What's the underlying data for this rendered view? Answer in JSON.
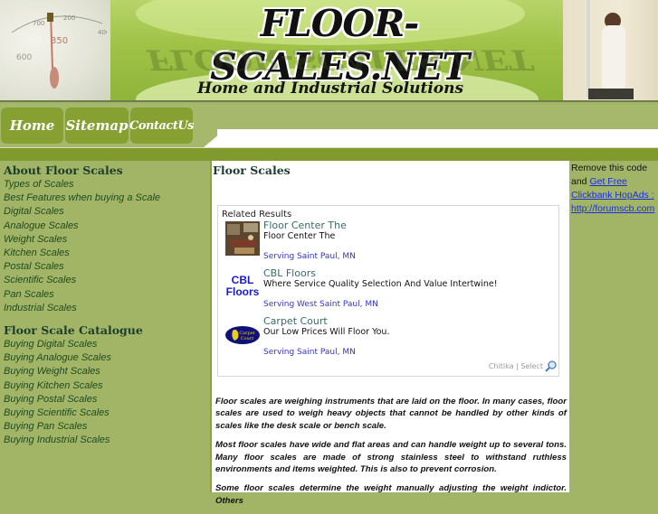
{
  "header": {
    "site_title": "FLOOR-SCALES.NET",
    "tagline": "Home and Industrial Solutions"
  },
  "nav": {
    "items": [
      {
        "label": "Home"
      },
      {
        "label": "Sitemap"
      },
      {
        "label": "ContactUs"
      }
    ]
  },
  "sidebar": {
    "groups": [
      {
        "heading": "About Floor Scales",
        "links": [
          "Types of Scales",
          "Best Features when buying a Scale",
          "Digital Scales",
          "Analogue Scales",
          "Weight Scales",
          "Kitchen Scales",
          "Postal Scales",
          "Scientific Scales",
          "Pan Scales",
          "Industrial Scales"
        ]
      },
      {
        "heading": "Floor Scale Catalogue",
        "links": [
          "Buying Digital Scales",
          "Buying Analogue Scales",
          "Buying Weight Scales",
          "Buying Kitchen Scales",
          "Buying Postal Scales",
          "Buying Scientific Scales",
          "Buying Pan Scales",
          "Buying Industrial Scales"
        ]
      }
    ]
  },
  "main": {
    "title": "Floor Scales",
    "ad_box": {
      "header": "Related Results",
      "items": [
        {
          "title": "Floor Center The",
          "desc": "Floor Center The",
          "location": "Serving Saint Paul, MN",
          "thumb": "store-photo"
        },
        {
          "title": "CBL Floors",
          "desc": "Where Service Quality Selection And Value Intertwine!",
          "location": "Serving West Saint Paul, MN",
          "thumb_text_1": "CBL",
          "thumb_text_2": "Floors"
        },
        {
          "title": "Carpet Court",
          "desc": "Our Low Prices Will Floor You.",
          "location": "Serving Saint Paul, MN",
          "thumb_text_1": "Carpet",
          "thumb_text_2": "Court"
        }
      ],
      "footer": "Chitika | Select",
      "footer_icon": "magnifier-icon"
    },
    "paragraphs": [
      "Floor scales are weighing instruments that are laid on the floor.  In many cases, floor scales are used to weigh heavy objects that cannot be handled by other kinds of scales like the desk scale or bench scale.",
      "Most floor scales have wide and flat areas and can handle weight up to several tons.  Many floor scales are made of strong stainless steel to withstand ruthless environments and items weighted.  This is also to prevent corrosion.",
      "Some floor scales determine the weight manually adjusting the weight indictor.  Others"
    ]
  },
  "right_ad": {
    "text": "Remove this code and",
    "link1": "Get Free",
    "link2": "Clickbank HopAds :",
    "link3": "http://forumscb.com"
  },
  "colors": {
    "sidebar_bg": "#a2b567",
    "nav_button": "#86a032",
    "green_bar": "#809a2e",
    "heading_text": "#1d3d2c",
    "link_text": "#1f4a1f",
    "ad_link": "#3535c0"
  }
}
